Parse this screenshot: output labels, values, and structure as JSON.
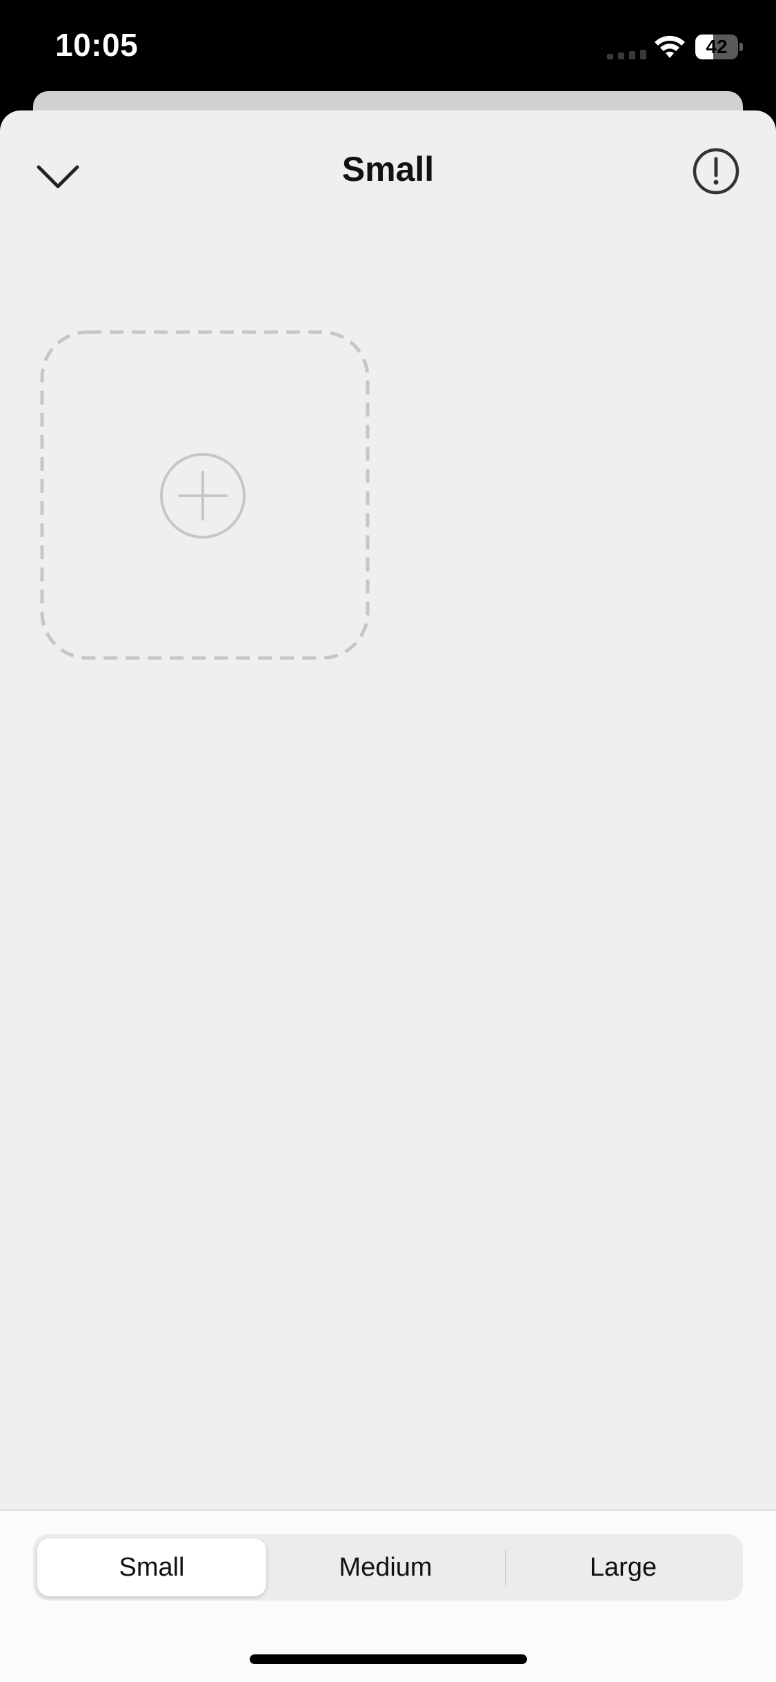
{
  "status_bar": {
    "time": "10:05",
    "battery_percent": 42,
    "battery_label": "42",
    "icons": [
      "cellular-signal-icon",
      "wifi-icon",
      "battery-icon"
    ]
  },
  "header": {
    "title": "Small",
    "left_icon": "chevron-down-icon",
    "right_icon": "info-exclamation-icon"
  },
  "widget_slot": {
    "icon": "plus-circle-icon"
  },
  "size_picker": {
    "options": [
      "Small",
      "Medium",
      "Large"
    ],
    "selected": "Small"
  },
  "colors": {
    "sheet_background": "#efefef",
    "dashed_border": "#c6c6c6",
    "status_bar": "#000000"
  }
}
